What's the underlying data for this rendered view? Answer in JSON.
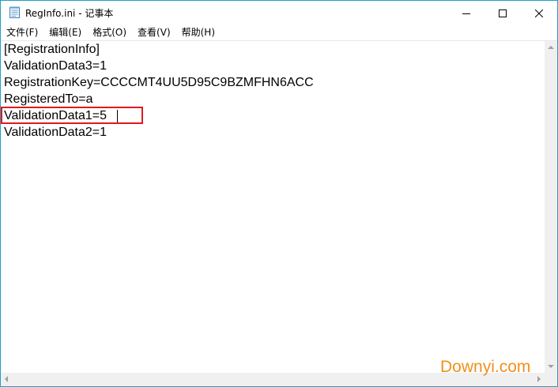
{
  "window": {
    "title": "RegInfo.ini - 记事本",
    "icon": "notepad-icon",
    "border_color": "#1fa0c8"
  },
  "caption_buttons": {
    "minimize": "minimize-icon",
    "maximize": "maximize-icon",
    "close": "close-icon"
  },
  "menu": {
    "items": [
      {
        "label": "文件(F)"
      },
      {
        "label": "编辑(E)"
      },
      {
        "label": "格式(O)"
      },
      {
        "label": "查看(V)"
      },
      {
        "label": "帮助(H)"
      }
    ]
  },
  "editor": {
    "lines": [
      "[RegistrationInfo]",
      "ValidationData3=1",
      "RegistrationKey=CCCCMT4UU5D95C9BZMFHN6ACC",
      "RegisteredTo=a",
      "ValidationData1=5",
      "ValidationData2=1"
    ],
    "highlight_color": "#e0191f"
  },
  "watermark": {
    "text": "Downyi.com",
    "color": "#f0901c"
  }
}
